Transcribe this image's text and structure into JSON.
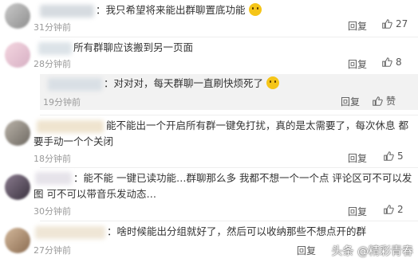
{
  "comments": [
    {
      "text": "我只希望将来能出群聊置底功能",
      "time": "31分钟前",
      "reply_label": "回复",
      "likes": "27"
    },
    {
      "text": "所有群聊应该搬到另一页面",
      "time": "28分钟前",
      "reply_label": "回复",
      "likes": "8"
    },
    {
      "text": "对对对，每天群聊一直刷快烦死了",
      "time": "19分钟前",
      "reply_label": "回复",
      "likes_label": "赞"
    },
    {
      "text_line1": "能不能出一个开启所有群一键免打扰，真的是太需要了，每次休息  都",
      "text_line2": "要手动一个个关闭",
      "time": "18分钟前",
      "reply_label": "回复",
      "likes": "5"
    },
    {
      "text_line1": "能不能 一键已读功能…群聊那么多 我都不想一个一个点  评论区可不可以发",
      "text_line2": "图  可不可以带音乐发动态…",
      "time": "30分钟前",
      "reply_label": "回复",
      "likes": "2"
    },
    {
      "text": "啥时候能出分组就好了，然后可以收纳那些不想点开的群",
      "time": "27分钟前",
      "reply_label": "回复"
    }
  ],
  "watermark": "头条 @精彩青春",
  "colors": {
    "text": "#333333",
    "meta": "#9a9a9a",
    "sub_reply_bg": "#f2f2f2"
  },
  "icons": [
    "thumb-up-icon",
    "smile-emoji-icon",
    "laugh-cry-emoji-icon"
  ]
}
